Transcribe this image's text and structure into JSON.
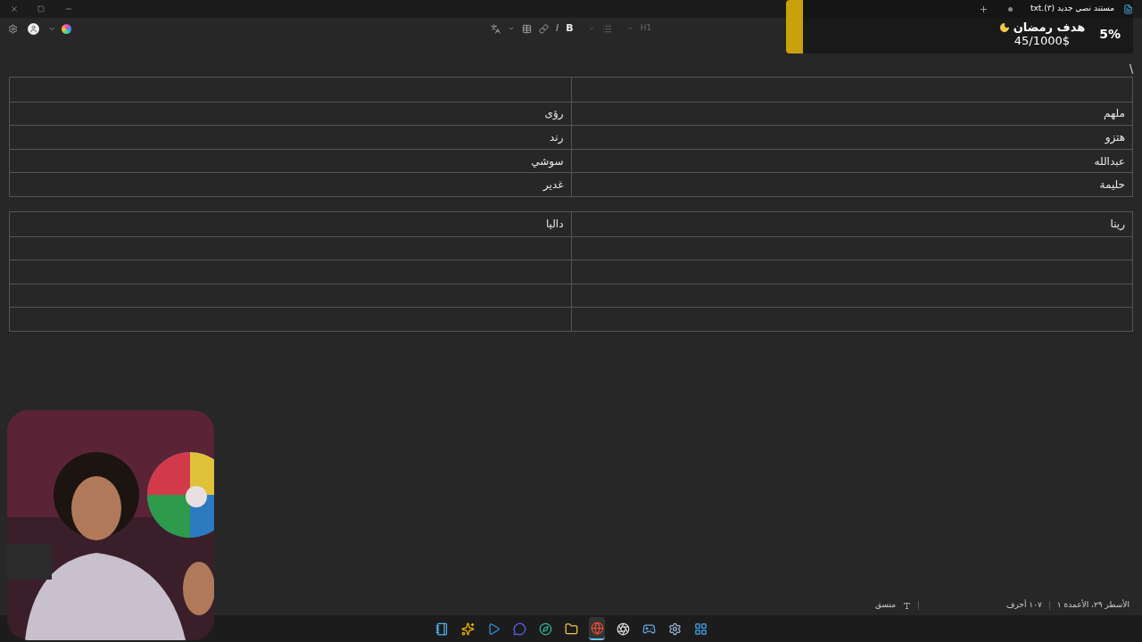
{
  "tab": {
    "title": "مستند نصي جديد (٣).txt"
  },
  "toolbar": {
    "italic": "I",
    "bold": "B",
    "heading": "H1"
  },
  "overlay": {
    "title": "هدف رمضان",
    "amount": "45/1000$",
    "percent": "5%"
  },
  "document": {
    "first_line": "\\",
    "tables": [
      {
        "rows": [
          [
            "",
            ""
          ],
          [
            "ملهم",
            "رؤى"
          ],
          [
            "هتزو",
            "رند"
          ],
          [
            "عبدالله",
            "سوشي"
          ],
          [
            "حليمة",
            "غدير"
          ]
        ]
      },
      {
        "rows": [
          [
            "رينا",
            "داليا"
          ],
          [
            "",
            ""
          ],
          [
            "",
            ""
          ],
          [
            "",
            ""
          ],
          [
            "",
            ""
          ]
        ]
      }
    ]
  },
  "status_bar": {
    "position": "الأسطر ٢٩، الأعمدة ١",
    "characters": "١٠٧ أحرف",
    "format": "منسق"
  },
  "taskbar": [
    {
      "selected": false
    },
    {
      "selected": false
    },
    {
      "selected": false
    },
    {
      "selected": false
    },
    {
      "selected": false
    },
    {
      "selected": false
    },
    {
      "selected": true
    },
    {
      "selected": false
    },
    {
      "selected": false
    },
    {
      "selected": false
    },
    {
      "selected": false
    }
  ]
}
